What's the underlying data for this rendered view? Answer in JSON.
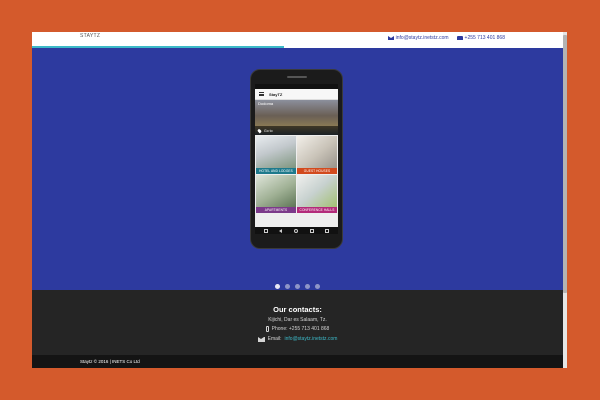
{
  "header": {
    "brand": "STAYTZ",
    "email": "info@staytz.inetstz.com",
    "phone": "+255 713 401 868"
  },
  "phone_app": {
    "title": "StayTZ",
    "city": "Dodoma",
    "search_label": "Go to",
    "tiles": [
      {
        "label": "HOTEL AND LODGES",
        "color": "#1e7a8c"
      },
      {
        "label": "GUEST HOUSES",
        "color": "#d24a1e"
      },
      {
        "label": "APARTMENTS",
        "color": "#7c3a8a"
      },
      {
        "label": "CONFERENCE HALLS",
        "color": "#b32b7a"
      }
    ]
  },
  "slider": {
    "dot_count": 5,
    "active_index": 0
  },
  "footer": {
    "heading": "Our contacts:",
    "address": "Kijichi, Dar es Salaam, Tz.",
    "phone": "Phone: +255 713 401 868",
    "email_label": "Email:",
    "email": "info@staytz.inetstz.com"
  },
  "bottom_bar": {
    "copyright": "Staytz © 2016 | INETS Co Ltd"
  },
  "colors": {
    "page_background": "#d45a2c",
    "hero": "#2d3a9f",
    "accent": "#3cb9c8",
    "footer": "#252525"
  }
}
